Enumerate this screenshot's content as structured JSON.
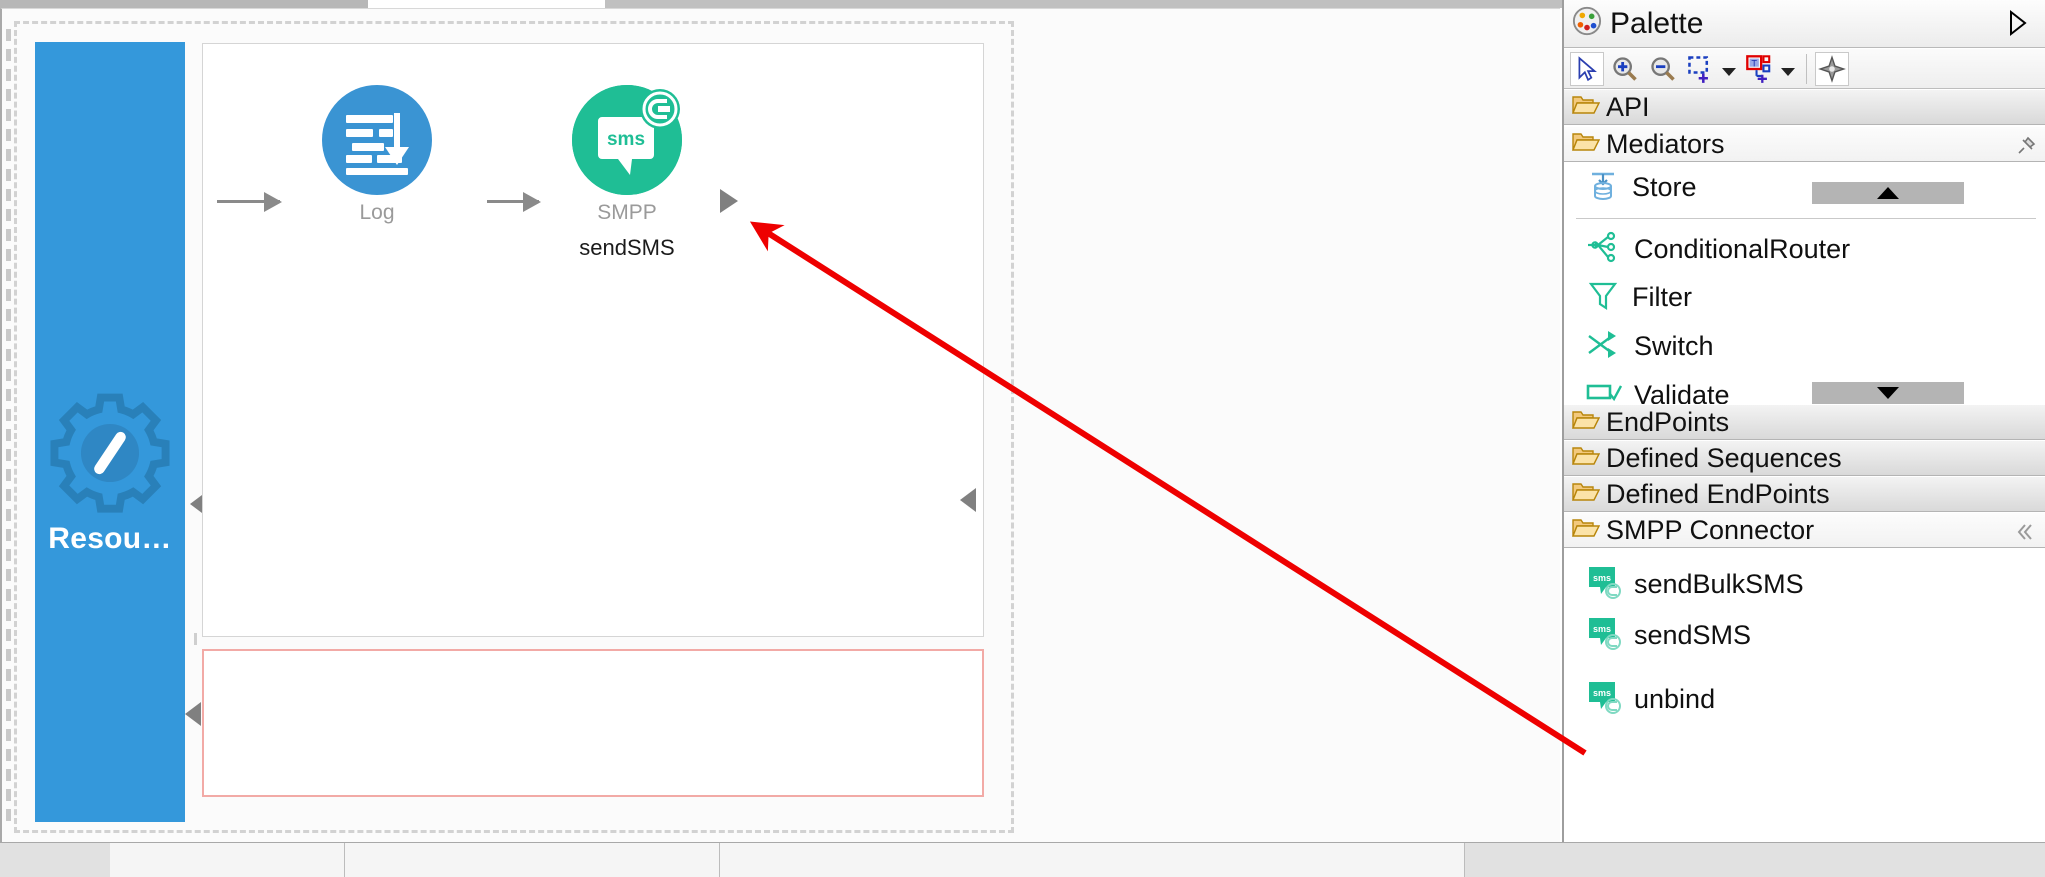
{
  "editor": {
    "resource_label": "Resou…",
    "nodes": [
      {
        "id": "log",
        "caption": "Log",
        "subcaption": "",
        "icon": "log-icon",
        "color": "#3a94d3"
      },
      {
        "id": "smpp",
        "caption": "SMPP",
        "subcaption": "sendSMS",
        "icon": "sms-connector-icon",
        "color": "#1fbe95"
      }
    ],
    "sms_badge_text": "sms"
  },
  "palette": {
    "title": "Palette",
    "title_icon": "palette-icon",
    "expand_icon": "expand-right-icon",
    "toolbar": [
      {
        "name": "select-tool",
        "icon": "cursor-arrow-icon",
        "selected": true
      },
      {
        "name": "zoom-in-tool",
        "icon": "zoom-in-icon",
        "selected": false
      },
      {
        "name": "zoom-out-tool",
        "icon": "zoom-out-icon",
        "selected": false
      },
      {
        "name": "marquee-tool",
        "icon": "marquee-select-icon",
        "selected": false
      },
      {
        "name": "marquee-dropdown",
        "icon": "chevron-down-icon",
        "selected": false
      },
      {
        "name": "create-connection-tool",
        "icon": "add-node-icon",
        "selected": false
      },
      {
        "name": "create-connection-dropdown",
        "icon": "chevron-down-icon",
        "selected": false
      },
      {
        "name": "pin-tool",
        "icon": "compass-icon",
        "selected": false
      }
    ],
    "sections": [
      {
        "name": "api",
        "label": "API",
        "icon": "folder-icon",
        "badge": ""
      },
      {
        "name": "mediators",
        "label": "Mediators",
        "icon": "folder-icon",
        "badge": "pin-icon"
      },
      {
        "name": "endpoints",
        "label": "EndPoints",
        "icon": "folder-icon",
        "badge": ""
      },
      {
        "name": "defined-sequences",
        "label": "Defined Sequences",
        "icon": "folder-icon",
        "badge": ""
      },
      {
        "name": "defined-endpoints",
        "label": "Defined EndPoints",
        "icon": "folder-icon",
        "badge": ""
      },
      {
        "name": "smpp-connector",
        "label": "SMPP Connector",
        "icon": "folder-icon",
        "badge": "collapse-icon"
      }
    ],
    "mediator_items": [
      {
        "name": "store",
        "label": "Store",
        "icon": "store-icon"
      },
      {
        "name": "conditional-router",
        "label": "ConditionalRouter",
        "icon": "conditional-router-icon"
      },
      {
        "name": "filter",
        "label": "Filter",
        "icon": "filter-icon"
      },
      {
        "name": "switch",
        "label": "Switch",
        "icon": "switch-icon"
      },
      {
        "name": "validate",
        "label": "Validate",
        "icon": "validate-icon"
      }
    ],
    "smpp_items": [
      {
        "name": "send-bulk-sms",
        "label": "sendBulkSMS",
        "icon": "sms-icon"
      },
      {
        "name": "send-sms",
        "label": "sendSMS",
        "icon": "sms-icon"
      },
      {
        "name": "unbind",
        "label": "unbind",
        "icon": "sms-icon"
      }
    ]
  },
  "colors": {
    "accent_blue": "#3498db",
    "log_blue": "#3a94d3",
    "connector_teal": "#1fbe95",
    "fault_border": "#f2aaa6",
    "annotation_red": "#ee0000",
    "folder_gold": "#e8a33d"
  }
}
